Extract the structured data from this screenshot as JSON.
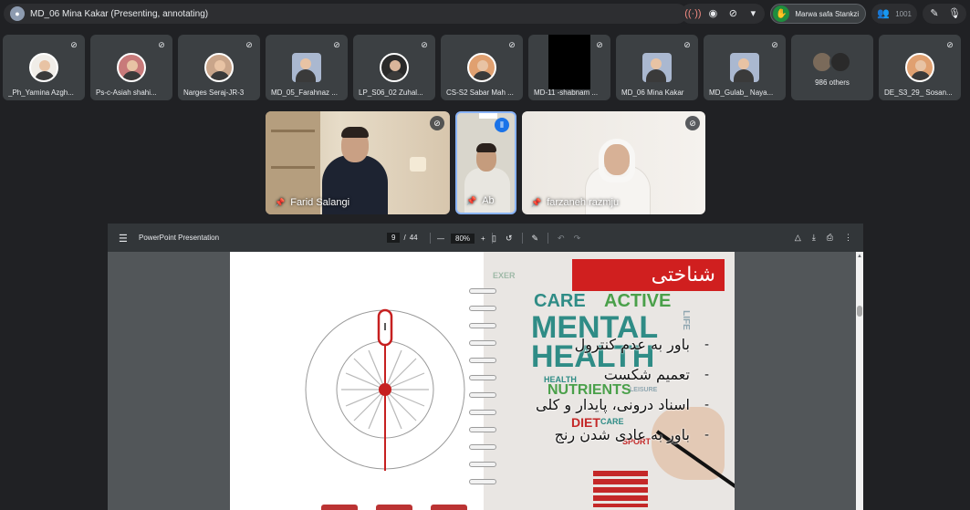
{
  "meeting": {
    "presenter_label": "MD_06 Mina Kakar (Presenting, annotating)",
    "hand_raised_name": "Marwa safa Stankzi",
    "people_count": "1001"
  },
  "participants": [
    {
      "name": "_Ph_Yamina Azgh..."
    },
    {
      "name": "Ps-c-Asiah shahi..."
    },
    {
      "name": "Narges Seraj-JR-3"
    },
    {
      "name": "MD_05_Farahnaz ..."
    },
    {
      "name": "LP_S06_02 Zuhal..."
    },
    {
      "name": "CS-S2 Sabar Mah ..."
    },
    {
      "name": "MD-11 -shabnam ..."
    },
    {
      "name": "MD_06 Mina Kakar"
    },
    {
      "name": "MD_Gulab_ Naya..."
    },
    {
      "name": "986 others"
    },
    {
      "name": "DE_S3_29_ Sosan..."
    }
  ],
  "videos": [
    {
      "name": "Farid Salangi"
    },
    {
      "name": "Ab"
    },
    {
      "name": "farzaneh razmju"
    }
  ],
  "viewer": {
    "title": "PowerPoint Presentation",
    "current_page": "9",
    "page_separator": "/",
    "total_pages": "44",
    "zoom": "80%"
  },
  "slide": {
    "title": "شناختی",
    "bullets": [
      "باور به عدم کنترول",
      "تعمیم شکست",
      "اسناد درونی، پایدار و کلی",
      "باور به عادی شدن رنج"
    ],
    "bullet_marker": "-",
    "wordcloud": [
      "CARE",
      "ACTIVE",
      "MENTAL",
      "HEALTH",
      "NUTRIENTS",
      "DIET",
      "LIFE",
      "SPORT",
      "CARE",
      "HEALTH",
      "LEISURE"
    ]
  },
  "colors": {
    "background": "#202124",
    "accent_green": "#1e8e3e",
    "slide_title_red": "#d01f1f",
    "wordcloud_teal": "#2f8c86",
    "wordcloud_green": "#4aa04a",
    "wordcloud_red": "#c42828"
  }
}
